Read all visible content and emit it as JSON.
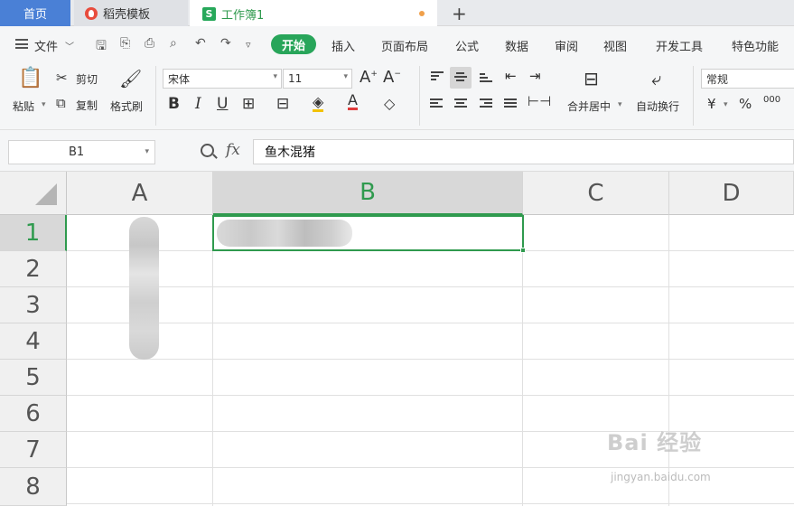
{
  "tabs": {
    "home": "首页",
    "templates": "稻壳模板",
    "workbook": "工作簿1",
    "workbook_icon": "S"
  },
  "menu": {
    "file": "文件",
    "items": [
      "开始",
      "插入",
      "页面布局",
      "公式",
      "数据",
      "审阅",
      "视图",
      "开发工具",
      "特色功能"
    ]
  },
  "ribbon": {
    "paste": "粘贴",
    "cut": "剪切",
    "copy": "复制",
    "format_painter": "格式刷",
    "font_name": "宋体",
    "font_size": "11",
    "merge_center": "合并居中",
    "wrap_text": "自动换行",
    "number_format": "常规",
    "currency_symbol": "¥",
    "percent_symbol": "%",
    "thousands_symbol": "000"
  },
  "formula_bar": {
    "name_box": "B1",
    "fx": "fx",
    "content": "鱼木混猪"
  },
  "grid": {
    "columns": [
      "A",
      "B",
      "C",
      "D"
    ],
    "rows": [
      "1",
      "2",
      "3",
      "4",
      "5",
      "6",
      "7",
      "8"
    ],
    "selected_cell": "B1",
    "accent_color": "#2f9a4e"
  },
  "watermark": {
    "main": "Bai 经验",
    "sub": "jingyan.baidu.com"
  }
}
